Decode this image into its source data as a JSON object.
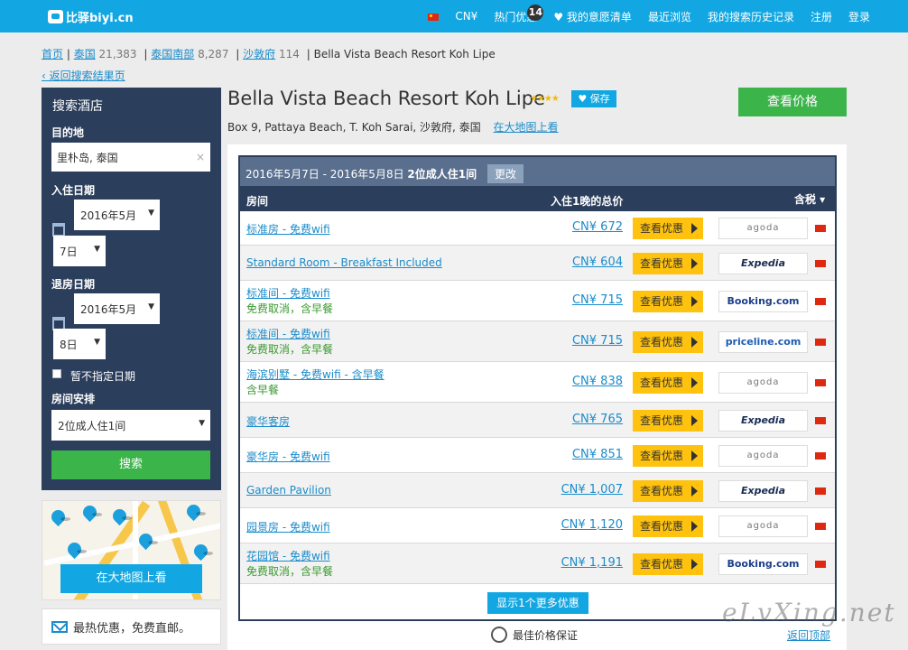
{
  "brand": {
    "name": "比驿biyi.cn"
  },
  "nav": {
    "currency": "CN¥",
    "hot_deals": "热门优惠",
    "hot_deals_count": "14",
    "wishlist": "我的意愿清单",
    "recent": "最近浏览",
    "search_history": "我的搜索历史记录",
    "register": "注册",
    "login": "登录"
  },
  "breadcrumb": {
    "home": "首页",
    "country": "泰国",
    "country_count": "21,383",
    "region": "泰国南部",
    "region_count": "8,287",
    "province": "沙敦府",
    "province_count": "114",
    "current": "Bella Vista Beach Resort Koh Lipe"
  },
  "back_link": "‹ 返回搜索结果页",
  "search": {
    "title": "搜索酒店",
    "destination_label": "目的地",
    "destination_value": "里朴岛, 泰国",
    "checkin_label": "入住日期",
    "checkin_month": "2016年5月",
    "checkin_day": "7日",
    "checkout_label": "退房日期",
    "checkout_month": "2016年5月",
    "checkout_day": "8日",
    "no_dates_label": "暂不指定日期",
    "rooms_label": "房间安排",
    "rooms_value": "2位成人住1间",
    "submit": "搜索"
  },
  "map": {
    "button": "在大地图上看"
  },
  "promo": {
    "text": "最热优惠，免费直邮。"
  },
  "hotel": {
    "name": "Bella Vista Beach Resort Koh Lipe",
    "stars": "★★★★",
    "save": "♥ 保存",
    "address": "Box 9, Pattaya Beach, T. Koh Sarai, 沙敦府, 泰国",
    "map_link": "在大地图上看",
    "cta": "查看价格"
  },
  "deals": {
    "date_range": "2016年5月7日 - 2016年5月8日",
    "guests": "2位成人住1间",
    "change": "更改",
    "col_room": "房间",
    "col_price": "入住1晚的总价",
    "col_tax": "含税 ▾",
    "button_label": "查看优惠",
    "rows": [
      {
        "room": "标准房 - 免费wifi",
        "sub": "",
        "price": "CN¥ 672",
        "vendor": "agoda"
      },
      {
        "room": "Standard Room - Breakfast Included",
        "sub": "",
        "price": "CN¥ 604",
        "vendor": "Expedia"
      },
      {
        "room": "标准间 - 免费wifi",
        "sub": "免费取消，含早餐",
        "price": "CN¥ 715",
        "vendor": "Booking.com"
      },
      {
        "room": "标准间 - 免费wifi",
        "sub": "免费取消，含早餐",
        "price": "CN¥ 715",
        "vendor": "priceline.com"
      },
      {
        "room": "海滨别墅 - 免费wifi - 含早餐",
        "sub": "含早餐",
        "price": "CN¥ 838",
        "vendor": "agoda"
      },
      {
        "room": "豪华客房",
        "sub": "",
        "price": "CN¥ 765",
        "vendor": "Expedia"
      },
      {
        "room": "豪华房 - 免费wifi",
        "sub": "",
        "price": "CN¥ 851",
        "vendor": "agoda"
      },
      {
        "room": "Garden Pavilion",
        "sub": "",
        "price": "CN¥ 1,007",
        "vendor": "Expedia"
      },
      {
        "room": "园景房 - 免费wifi",
        "sub": "",
        "price": "CN¥ 1,120",
        "vendor": "agoda"
      },
      {
        "room": "花园馆 - 免费wifi",
        "sub": "免费取消，含早餐",
        "price": "CN¥ 1,191",
        "vendor": "Booking.com"
      }
    ],
    "more": "显示1个更多优惠"
  },
  "footer": {
    "guarantee": "最佳价格保证",
    "back_top": "返回顶部",
    "watermark": "eLvXing.net"
  }
}
